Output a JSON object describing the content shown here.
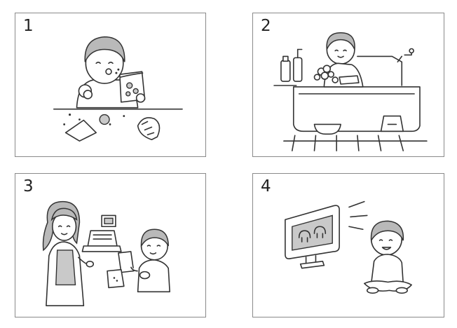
{
  "panels": [
    {
      "number": "1",
      "icon": "child-eating-snacks-icon"
    },
    {
      "number": "2",
      "icon": "child-in-bath-icon"
    },
    {
      "number": "3",
      "icon": "child-at-shop-counter-icon"
    },
    {
      "number": "4",
      "icon": "child-watching-tv-icon"
    }
  ]
}
